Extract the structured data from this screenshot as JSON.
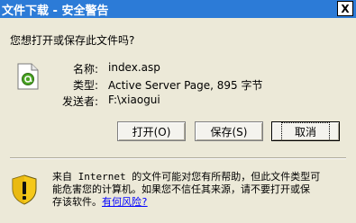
{
  "window": {
    "title": "文件下载 - 安全警告",
    "close_label": "X"
  },
  "prompt": {
    "question": "您想打开或保存此文件吗?"
  },
  "file": {
    "icon": "asp-file-icon",
    "name_label": "名称:",
    "name_value": "index.asp",
    "type_label": "类型:",
    "type_value": "Active Server Page, 895 字节",
    "from_label": "发送者:",
    "from_value": "F:\\xiaogui"
  },
  "buttons": {
    "open": "打开(O)",
    "save": "保存(S)",
    "cancel": "取消"
  },
  "warning": {
    "line1": "来自 Internet 的文件可能对您有所帮助，但此文件类型可",
    "line2": "能危害您的计算机。如果您不信任其来源，请不要打开或保",
    "line3_prefix": "存该软件。",
    "link_text": "有何风险?",
    "icon": "shield-warning-icon"
  },
  "colors": {
    "titlebar": "#2c7bd7",
    "dialog_bg": "#ece9d8",
    "link": "#0000ff",
    "shield_yellow": "#f5c81a"
  }
}
